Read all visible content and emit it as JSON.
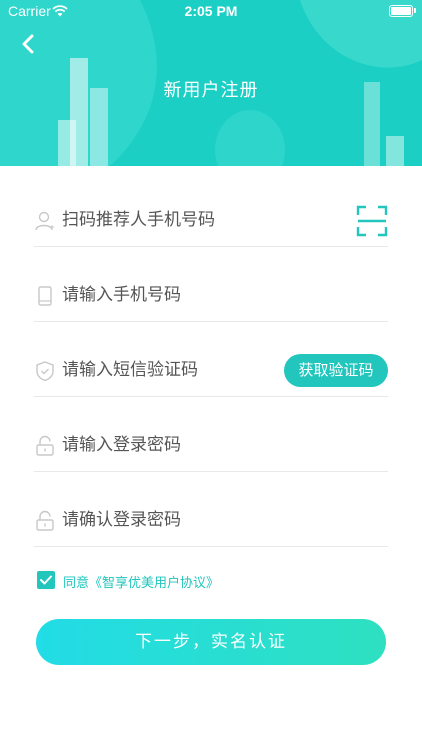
{
  "status_bar": {
    "carrier": "Carrier",
    "time": "2:05 PM"
  },
  "header": {
    "title": "新用户注册",
    "background_color": "#1ccfc4"
  },
  "form": {
    "referrer_placeholder": "扫码推荐人手机号码",
    "phone_placeholder": "请输入手机号码",
    "sms_code_placeholder": "请输入短信验证码",
    "get_code_label": "获取验证码",
    "password_placeholder": "请输入登录密码",
    "confirm_password_placeholder": "请确认登录密码"
  },
  "agreement": {
    "checked": true,
    "text": "同意《智享优美用户协议》"
  },
  "submit": {
    "label": "下一步，实名认证"
  },
  "colors": {
    "accent": "#22c6bc",
    "button_gradient_start": "#22dce6",
    "button_gradient_end": "#2ee0c0"
  },
  "icons": [
    "back-icon",
    "wifi-icon",
    "battery-icon",
    "user-icon",
    "scan-icon",
    "phone-icon",
    "shield-icon",
    "lock-icon"
  ]
}
